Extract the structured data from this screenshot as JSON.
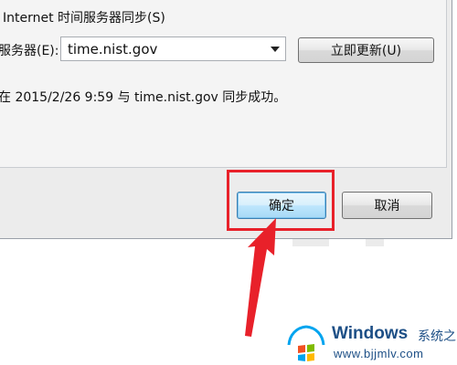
{
  "dialog": {
    "sync_checkbox_label": "Internet 时间服务器同步(S)",
    "server_label": "服务器(E):",
    "server_combo": {
      "value": "time.nist.gov",
      "arrow_icon": "chevron-down-icon"
    },
    "update_button_label": "立即更新(U)",
    "status_message": "在 2015/2/26 9:59 与 time.nist.gov 同步成功。",
    "ok_button_label": "确定",
    "cancel_button_label": "取消"
  },
  "annotation": {
    "highlight_color": "#e8212a",
    "arrow_color": "#e8212a"
  },
  "watermark": {
    "title": "Windows",
    "title_cn": "系统之家",
    "url": "www.bjjmlv.com",
    "logo_icon": "windows-logo-icon",
    "colors": {
      "red": "#f25022",
      "green": "#7fba00",
      "blue": "#00a4ef",
      "yellow": "#ffb900",
      "text": "#1d4f86"
    }
  }
}
